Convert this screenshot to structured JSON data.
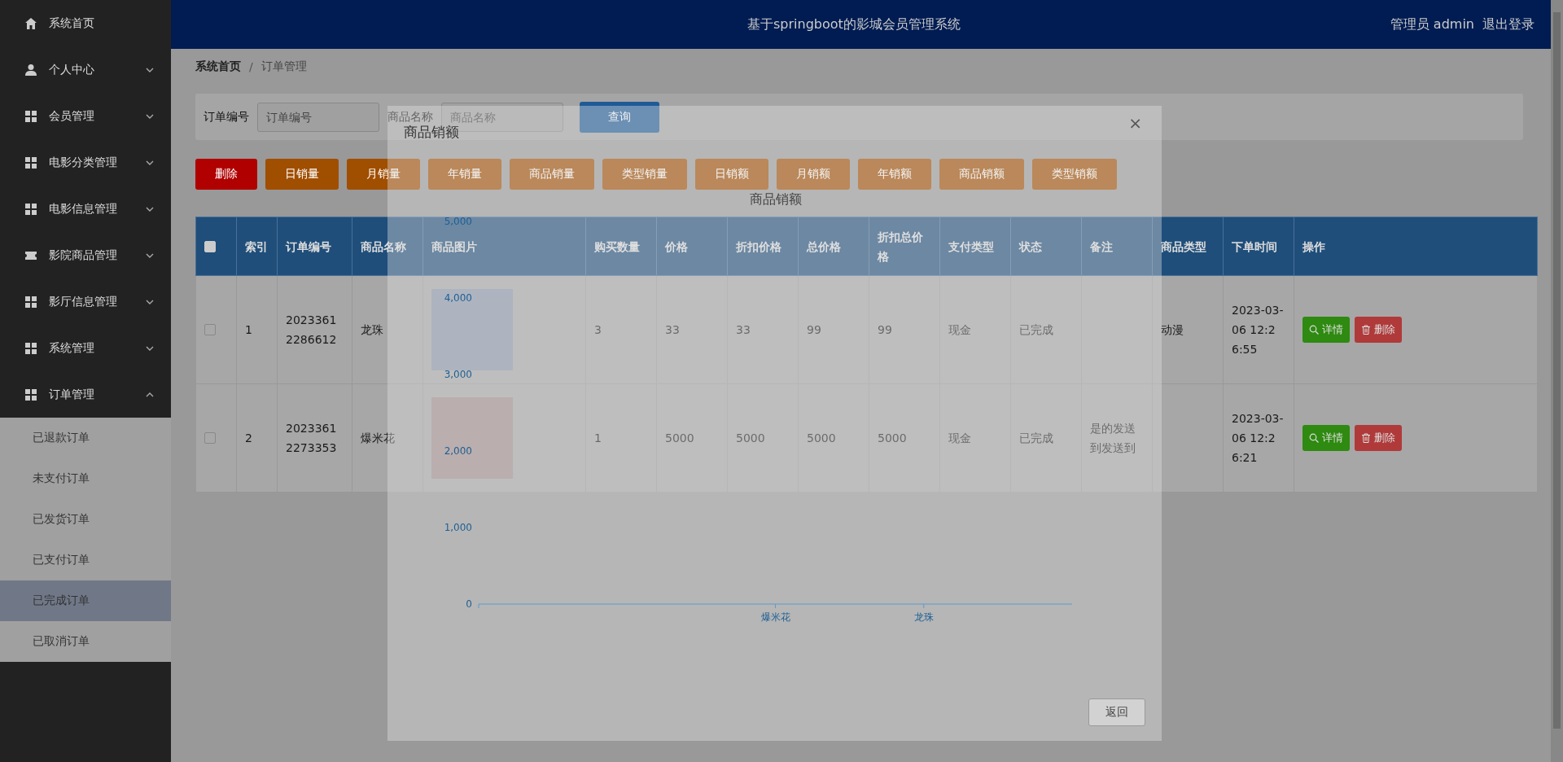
{
  "sidebar": {
    "items": [
      {
        "label": "系统首页",
        "kind": "home"
      },
      {
        "label": "个人中心",
        "kind": "user",
        "expanded": false
      },
      {
        "label": "会员管理",
        "kind": "grid",
        "expanded": false
      },
      {
        "label": "电影分类管理",
        "kind": "grid",
        "expanded": false
      },
      {
        "label": "电影信息管理",
        "kind": "grid",
        "expanded": false
      },
      {
        "label": "影院商品管理",
        "kind": "ticket",
        "expanded": false
      },
      {
        "label": "影厅信息管理",
        "kind": "grid",
        "expanded": false
      },
      {
        "label": "系统管理",
        "kind": "grid",
        "expanded": false
      },
      {
        "label": "订单管理",
        "kind": "grid",
        "expanded": true,
        "children": [
          {
            "label": "已退款订单",
            "selected": false
          },
          {
            "label": "未支付订单",
            "selected": false
          },
          {
            "label": "已发货订单",
            "selected": false
          },
          {
            "label": "已支付订单",
            "selected": false
          },
          {
            "label": "已完成订单",
            "selected": true
          },
          {
            "label": "已取消订单",
            "selected": false
          }
        ]
      }
    ]
  },
  "header": {
    "title": "基于springboot的影城会员管理系统",
    "user": "管理员 admin",
    "logout": "退出登录"
  },
  "breadcrumb": {
    "separator": "/",
    "items": [
      {
        "label": "系统首页",
        "current": false
      },
      {
        "label": "订单管理",
        "current": true
      }
    ]
  },
  "search": {
    "fields": [
      {
        "label": "订单编号",
        "placeholder": "订单编号"
      },
      {
        "label": "商品名称",
        "placeholder": "商品名称"
      }
    ],
    "button": "查询"
  },
  "actions": [
    {
      "label": "删除",
      "kind": "danger"
    },
    {
      "label": "日销量",
      "kind": "report"
    },
    {
      "label": "月销量",
      "kind": "report"
    },
    {
      "label": "年销量",
      "kind": "report"
    },
    {
      "label": "商品销量",
      "kind": "report"
    },
    {
      "label": "类型销量",
      "kind": "report"
    },
    {
      "label": "日销额",
      "kind": "report"
    },
    {
      "label": "月销额",
      "kind": "report"
    },
    {
      "label": "年销额",
      "kind": "report"
    },
    {
      "label": "商品销额",
      "kind": "report"
    },
    {
      "label": "类型销额",
      "kind": "report"
    }
  ],
  "table": {
    "header_checked": false,
    "columns": [
      "索引",
      "订单编号",
      "商品名称",
      "商品图片",
      "购买数量",
      "价格",
      "折扣价格",
      "总价格",
      "折扣总价格",
      "支付类型",
      "状态",
      "备注",
      "商品类型",
      "下单时间",
      "操作"
    ],
    "rows": [
      {
        "checked": false,
        "cells": [
          "1",
          "20233612286612",
          "龙珠",
          null,
          "3",
          "33",
          "33",
          "99",
          "99",
          "现金",
          "已完成",
          "",
          "动漫",
          "2023-03-06 12:26:55"
        ],
        "buttons": [
          "详情",
          "删除"
        ]
      },
      {
        "checked": false,
        "cells": [
          "2",
          "20233612273353",
          "爆米花",
          null,
          "1",
          "5000",
          "5000",
          "5000",
          "5000",
          "现金",
          "已完成",
          "是的发送到发送到",
          "",
          "2023-03-06 12:26:21"
        ],
        "buttons": [
          "详情",
          "删除"
        ]
      }
    ]
  },
  "modal": {
    "title": "商品销额",
    "close": "×",
    "button": "返回",
    "chart_data": {
      "type": "bar",
      "title": "商品销额",
      "categories": [
        "爆米花",
        "龙珠"
      ],
      "values": [
        0,
        0
      ],
      "ylim": [
        0,
        5000
      ],
      "yticks": [
        {
          "value": 0,
          "label": "0"
        },
        {
          "value": 1000,
          "label": "1,000"
        },
        {
          "value": 2000,
          "label": "2,000"
        },
        {
          "value": 3000,
          "label": "3,000"
        },
        {
          "value": 4000,
          "label": "4,000"
        },
        {
          "value": 5000,
          "label": "5,000"
        }
      ]
    }
  }
}
